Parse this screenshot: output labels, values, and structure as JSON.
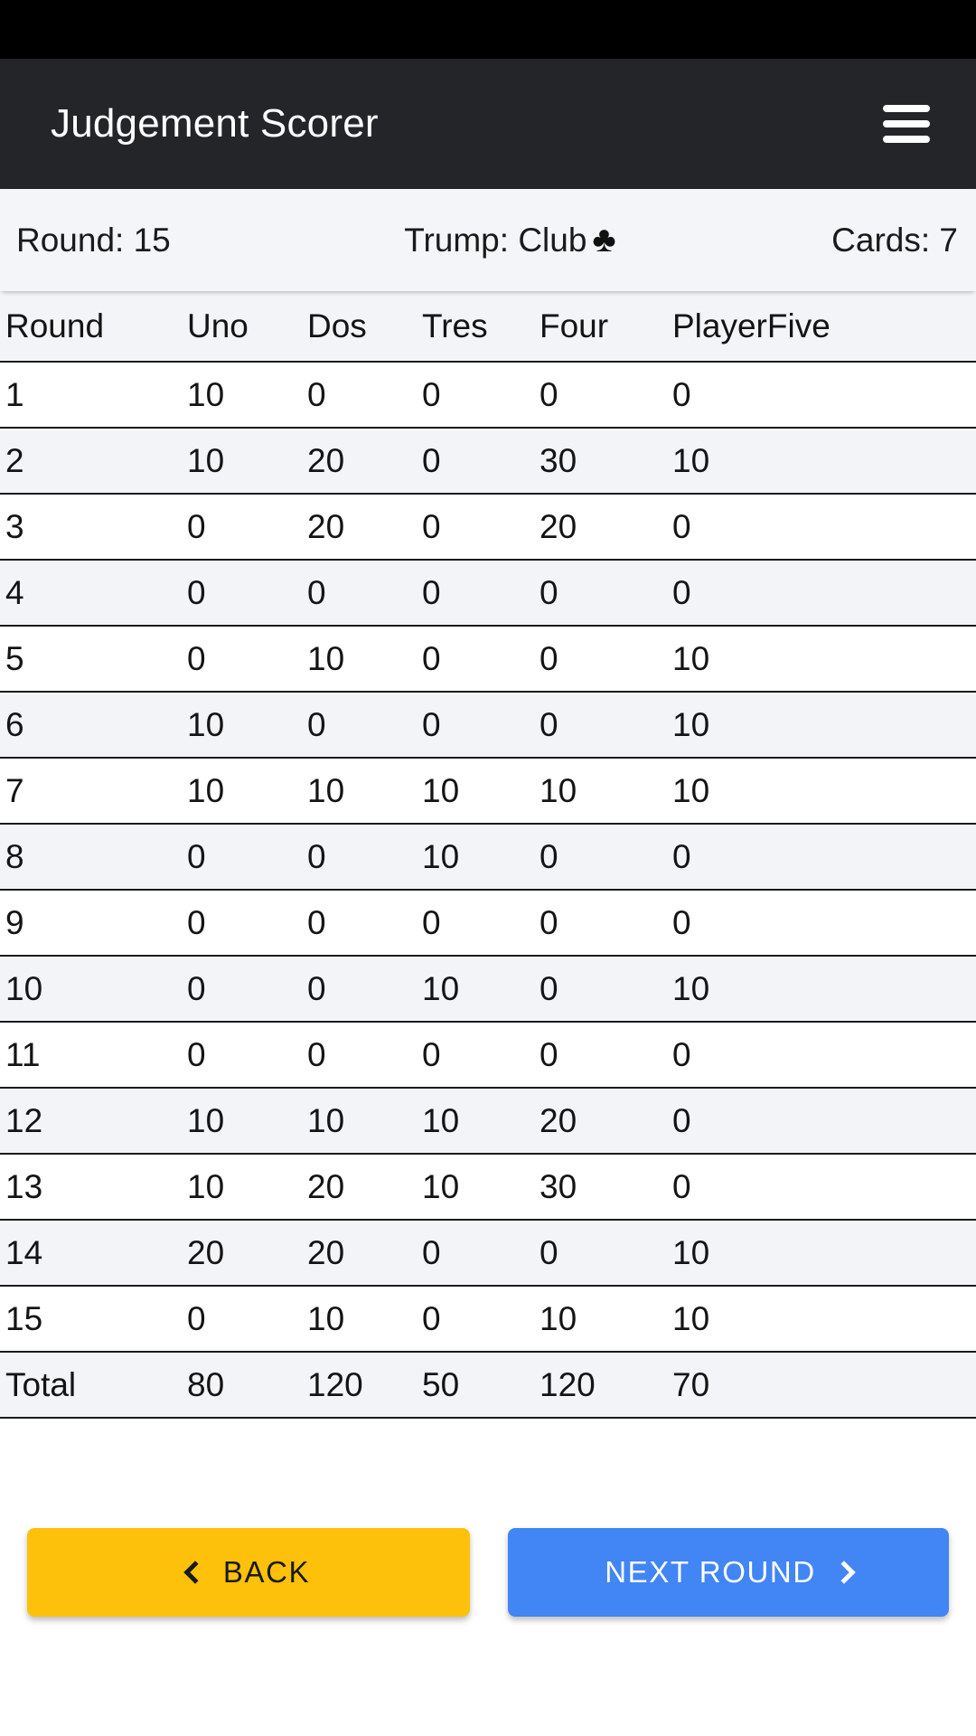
{
  "status_bar": {
    "visible": true
  },
  "app_bar": {
    "title": "Judgement Scorer",
    "menu_icon": "hamburger-menu-icon"
  },
  "info_bar": {
    "round_label": "Round: 15",
    "trump_label": "Trump: Club",
    "trump_suit_glyph": "♣",
    "cards_label": "Cards: 7"
  },
  "score_table": {
    "columns": [
      "Round",
      "Uno",
      "Dos",
      "Tres",
      "Four",
      "PlayerFive"
    ],
    "rows": [
      [
        "1",
        "10",
        "0",
        "0",
        "0",
        "0"
      ],
      [
        "2",
        "10",
        "20",
        "0",
        "30",
        "10"
      ],
      [
        "3",
        "0",
        "20",
        "0",
        "20",
        "0"
      ],
      [
        "4",
        "0",
        "0",
        "0",
        "0",
        "0"
      ],
      [
        "5",
        "0",
        "10",
        "0",
        "0",
        "10"
      ],
      [
        "6",
        "10",
        "0",
        "0",
        "0",
        "10"
      ],
      [
        "7",
        "10",
        "10",
        "10",
        "10",
        "10"
      ],
      [
        "8",
        "0",
        "0",
        "10",
        "0",
        "0"
      ],
      [
        "9",
        "0",
        "0",
        "0",
        "0",
        "0"
      ],
      [
        "10",
        "0",
        "0",
        "10",
        "0",
        "10"
      ],
      [
        "11",
        "0",
        "0",
        "0",
        "0",
        "0"
      ],
      [
        "12",
        "10",
        "10",
        "10",
        "20",
        "0"
      ],
      [
        "13",
        "10",
        "20",
        "10",
        "30",
        "0"
      ],
      [
        "14",
        "20",
        "20",
        "0",
        "0",
        "10"
      ],
      [
        "15",
        "0",
        "10",
        "0",
        "10",
        "10"
      ]
    ],
    "total_row": [
      "Total",
      "80",
      "120",
      "50",
      "120",
      "70"
    ]
  },
  "footer": {
    "back_label": "BACK",
    "back_icon": "chevron-left-icon",
    "back_color": "#FDC10B",
    "next_label": "NEXT ROUND",
    "next_icon": "chevron-right-icon",
    "next_color": "#4285F4"
  }
}
